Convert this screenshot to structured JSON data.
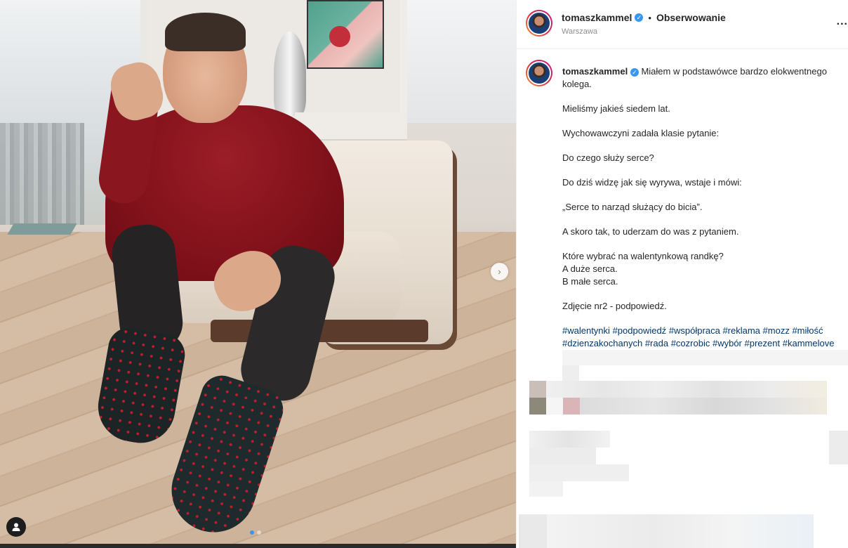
{
  "post": {
    "username": "tomaszkammel",
    "follow_label": "Obserwowanie",
    "separator": "•",
    "location": "Warszawa",
    "more_label": "...",
    "next_arrow": "›",
    "verified_mark": "✓"
  },
  "caption": {
    "username": "tomaszkammel",
    "first_line": "Miałem w podstawówce bardzo elokwentnego kolega.",
    "paragraphs": [
      "Mieliśmy jakieś siedem lat.",
      "Wychowawczyni zadała klasie pytanie:",
      "Do czego służy serce?",
      "Do dziś widzę jak się wyrywa, wstaje i mówi:",
      "„Serce to narząd służący do bicia”.",
      "A skoro tak, to uderzam do was z pytaniem."
    ],
    "question": "Które wybrać na walentynkową randkę?",
    "option_a": "A duże serca.",
    "option_b": "B małe serca.",
    "hint": "Zdjęcie nr2 - podpowiedź.",
    "hashtags_line1": [
      "#walentynki",
      "#podpowiedź",
      "#współpraca",
      "#reklama",
      "#mozz",
      "#miłość"
    ],
    "hashtags_line2": [
      "#dzienzakochanych",
      "#rada",
      "#cozrobic",
      "#wybór",
      "#prezent",
      "#kammelove"
    ]
  },
  "carousel": {
    "slide_count": 2,
    "active_index": 0
  },
  "colors": {
    "link": "#00376b",
    "verified": "#3897f0",
    "secondary_text": "#8e8e8e"
  },
  "icons": {
    "more": "more-options-icon",
    "next": "chevron-right-icon",
    "tag": "user-tag-icon",
    "verified": "verified-badge-icon"
  }
}
